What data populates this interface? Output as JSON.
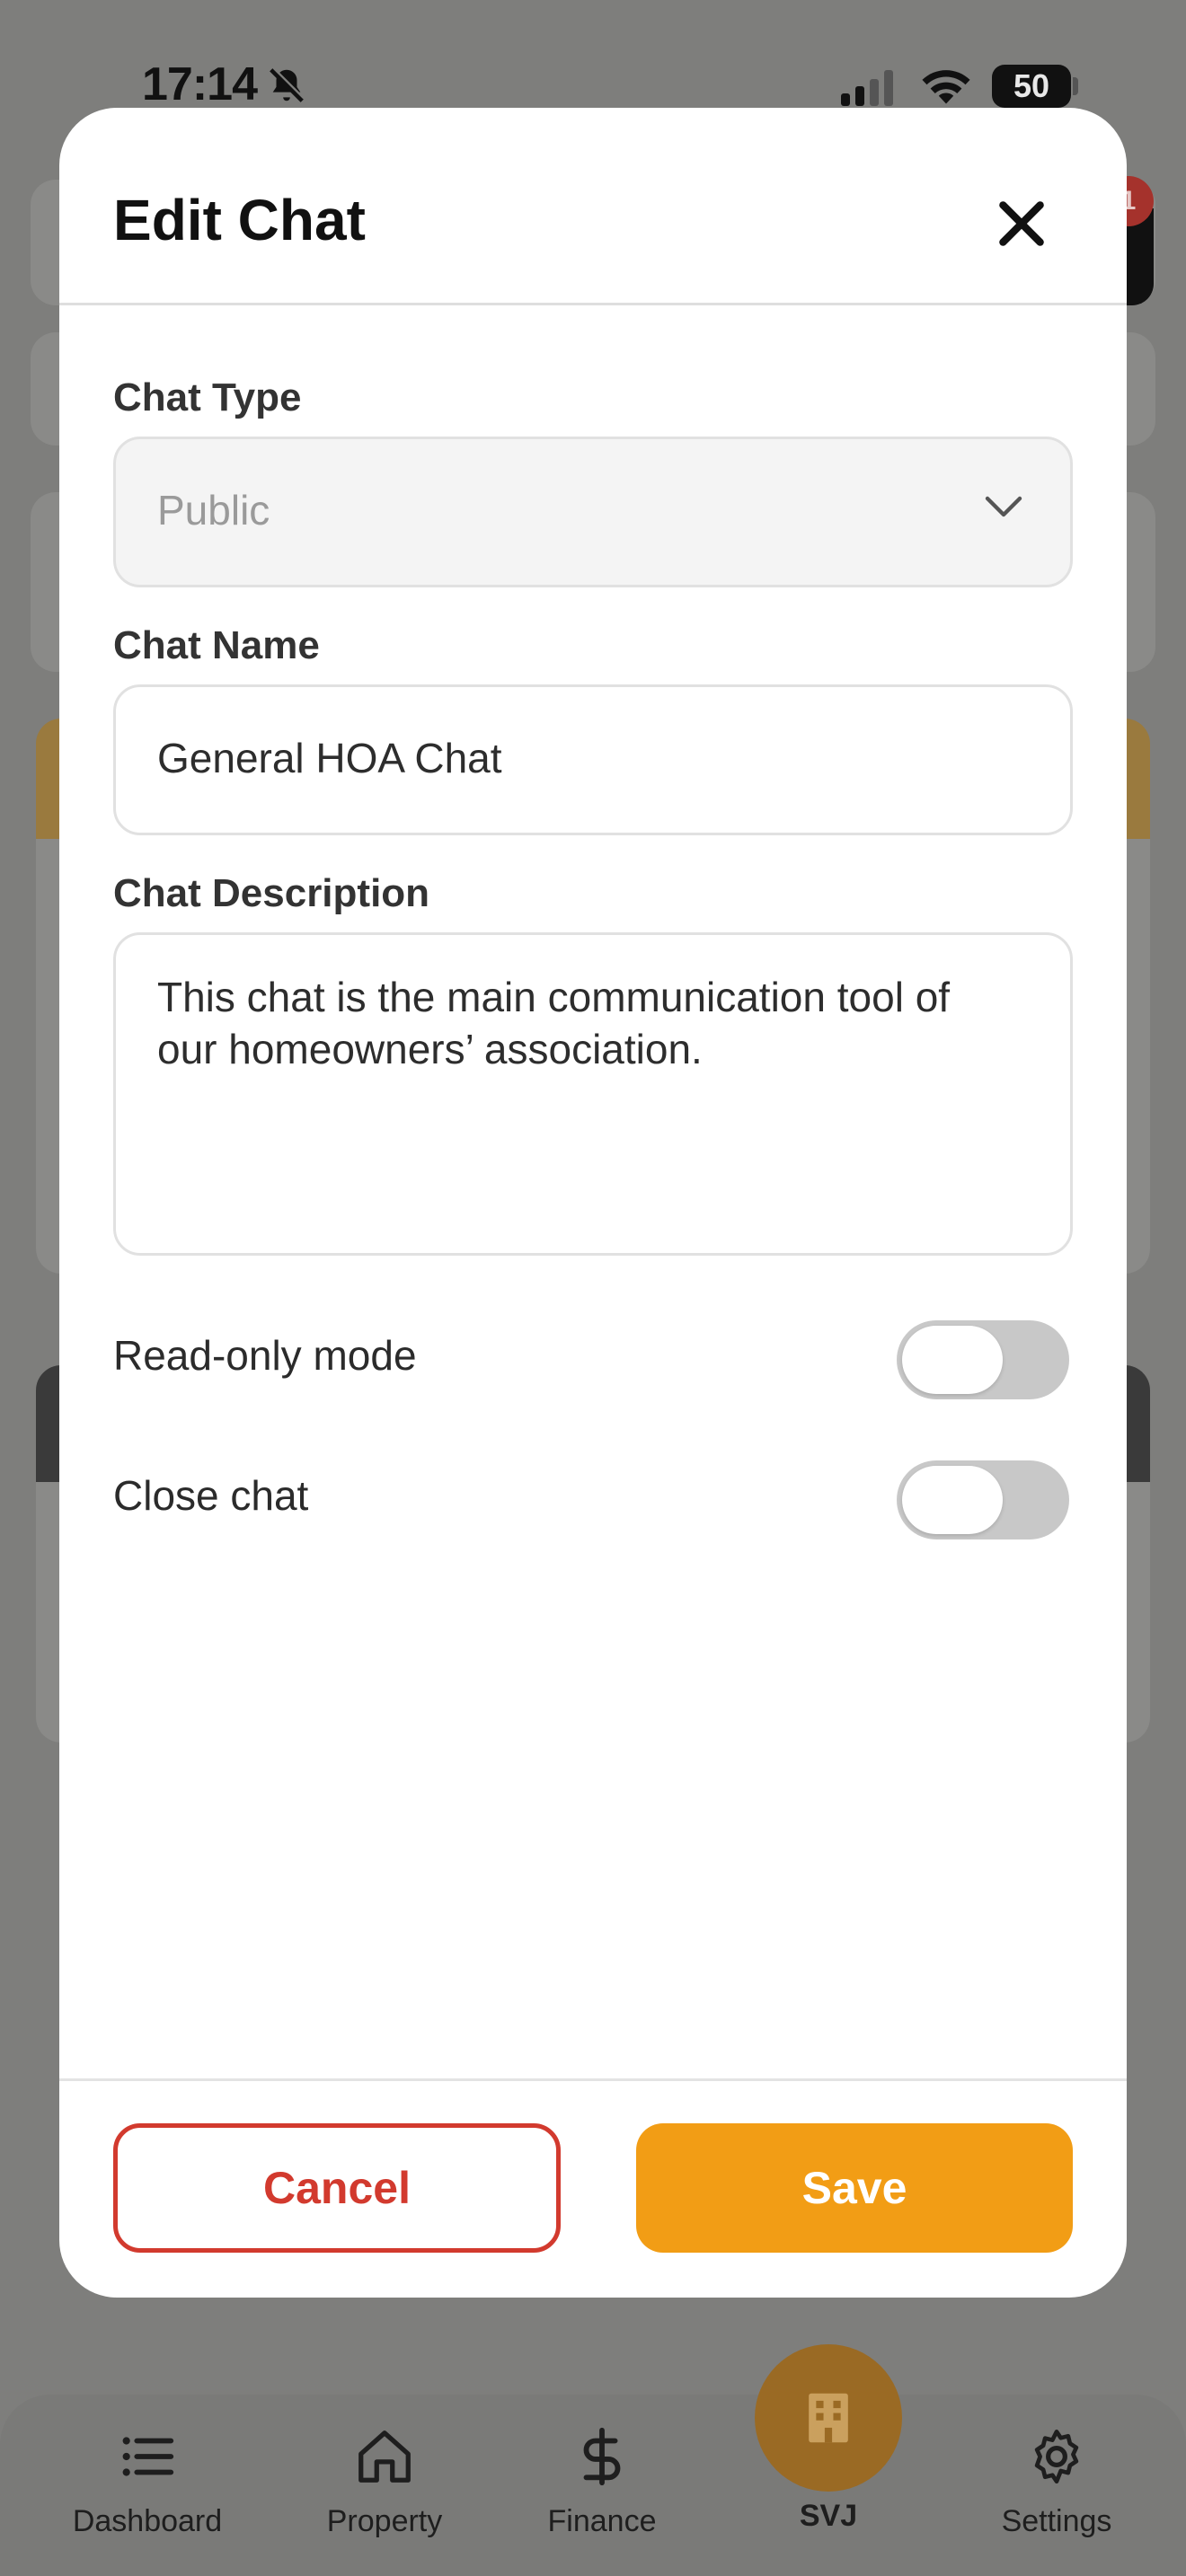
{
  "status_bar": {
    "time": "17:14",
    "battery": "50"
  },
  "background": {
    "badge_count": "1"
  },
  "modal": {
    "title": "Edit Chat",
    "chat_type": {
      "label": "Chat Type",
      "value": "Public"
    },
    "chat_name": {
      "label": "Chat Name",
      "value": "General HOA Chat"
    },
    "chat_description": {
      "label": "Chat Description",
      "value": "This chat is the main communication tool of our homeowners’ association."
    },
    "read_only": {
      "label": "Read-only mode",
      "on": false
    },
    "close_chat": {
      "label": "Close chat",
      "on": false
    },
    "cancel_label": "Cancel",
    "save_label": "Save"
  },
  "colors": {
    "accent": "#f29d15",
    "danger": "#d23a2e",
    "toggle_off": "#c8c8c8"
  },
  "bottom_nav": {
    "items": [
      {
        "label": "Dashboard",
        "icon": "list-icon"
      },
      {
        "label": "Property",
        "icon": "home-icon"
      },
      {
        "label": "Finance",
        "icon": "dollar-icon"
      },
      {
        "label": "SVJ",
        "icon": "building-icon"
      },
      {
        "label": "Settings",
        "icon": "gear-icon"
      }
    ]
  }
}
